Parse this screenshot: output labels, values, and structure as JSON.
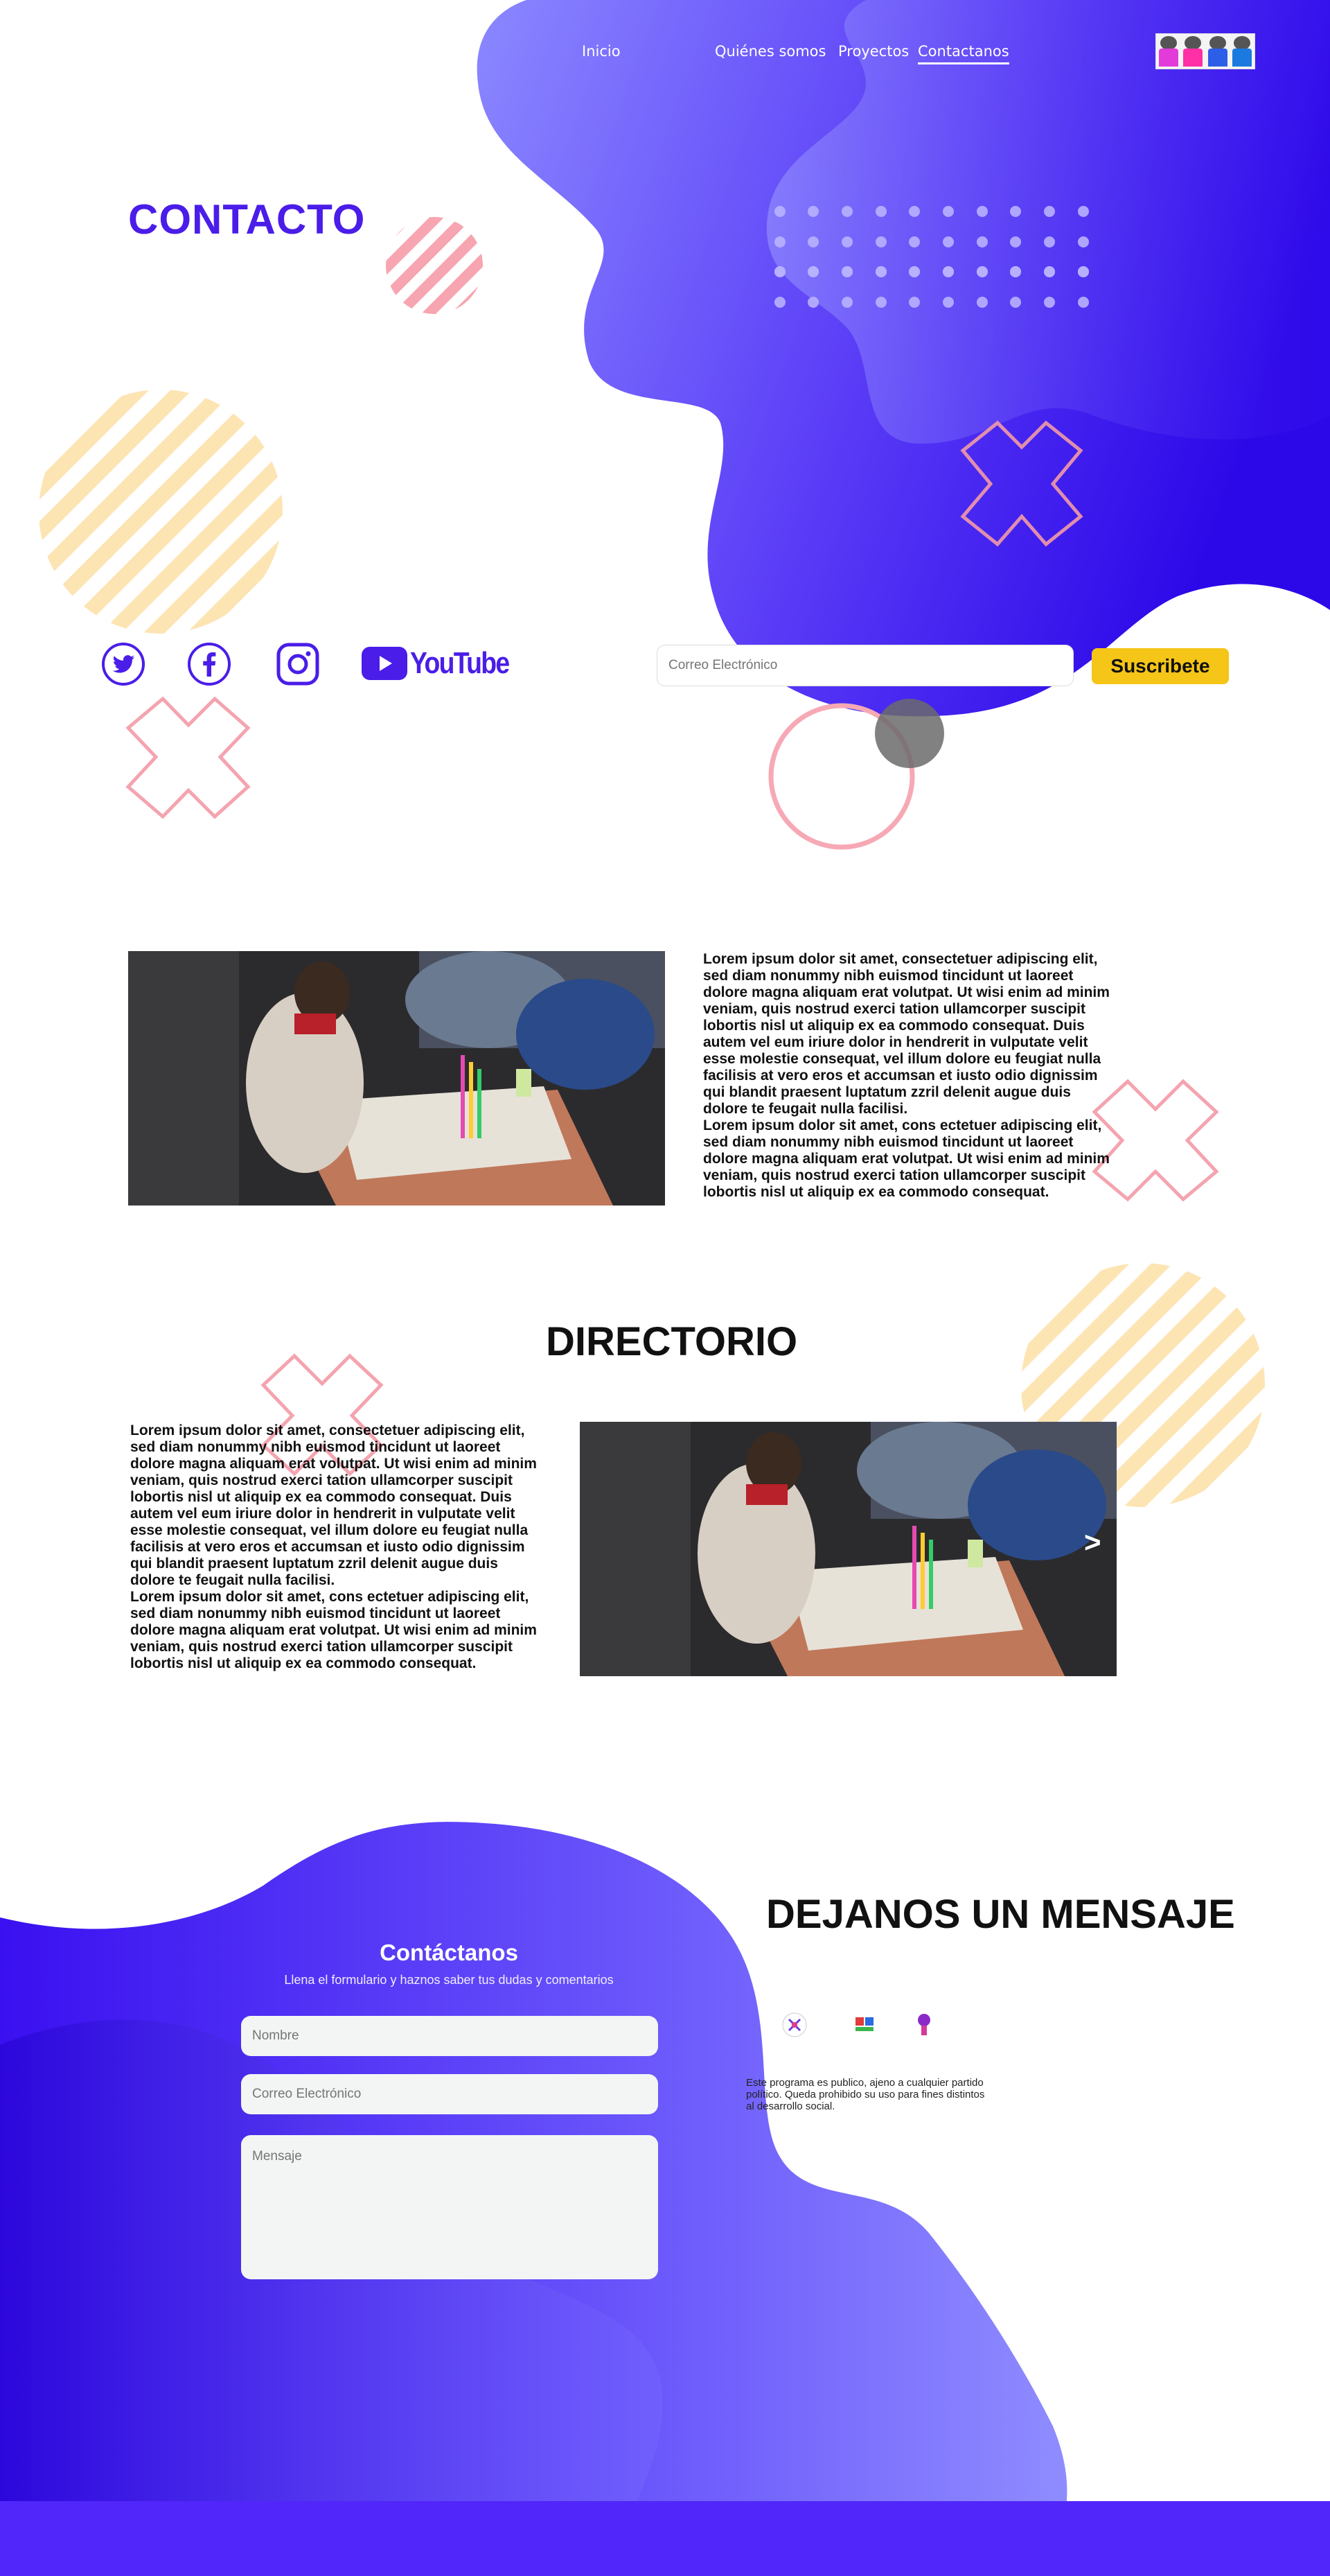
{
  "nav": {
    "items": [
      {
        "label": "Inicio"
      },
      {
        "label": "Quiénes somos"
      },
      {
        "label": "Proyectos"
      },
      {
        "label": "Contactanos"
      }
    ]
  },
  "hero": {
    "title": "CONTACTO"
  },
  "social": {
    "youtube_label": "YouTube"
  },
  "subscribe": {
    "email_placeholder": "Correo Electrónico",
    "button_label": "Suscribete"
  },
  "intro": {
    "paragraph": "Lorem ipsum dolor sit amet, consectetuer adipiscing elit, sed diam nonummy nibh euismod tincidunt ut laoreet dolore magna aliquam erat volutpat. Ut wisi enim ad minim veniam, quis nostrud exerci tation ullamcorper suscipit lobortis nisl ut aliquip ex ea commodo consequat. Duis autem vel eum iriure dolor in hendrerit in vulputate velit esse molestie consequat, vel illum dolore eu feugiat nulla facilisis at vero eros et accumsan et iusto odio dignissim qui blandit praesent luptatum zzril delenit augue duis dolore te feugait nulla facilisi.\nLorem ipsum dolor sit amet, cons ectetuer adipiscing elit, sed diam nonummy nibh euismod tincidunt ut laoreet dolore magna aliquam erat volutpat. Ut wisi enim ad minim veniam, quis nostrud exerci tation ullamcorper suscipit lobortis nisl ut aliquip ex ea commodo consequat."
  },
  "directorio": {
    "title": "DIRECTORIO",
    "paragraph": "Lorem ipsum dolor sit amet, consectetuer adipiscing elit, sed diam nonummy nibh euismod tincidunt ut laoreet dolore magna aliquam erat volutpat. Ut wisi enim ad minim veniam, quis nostrud exerci tation ullamcorper suscipit lobortis nisl ut aliquip ex ea commodo consequat. Duis autem vel eum iriure dolor in hendrerit in vulputate velit esse molestie consequat, vel illum dolore eu feugiat nulla facilisis at vero eros et accumsan et iusto odio dignissim qui blandit praesent luptatum zzril delenit augue duis dolore te feugait nulla facilisi.\nLorem ipsum dolor sit amet, cons ectetuer adipiscing elit, sed diam nonummy nibh euismod tincidunt ut laoreet dolore magna aliquam erat volutpat. Ut wisi enim ad minim veniam, quis nostrud exerci tation ullamcorper suscipit lobortis nisl ut aliquip ex ea commodo consequat.",
    "next_arrow": ">"
  },
  "contact_form": {
    "title": "Contáctanos",
    "subtitle": "Llena el formulario y haznos saber tus dudas y comentarios",
    "name_placeholder": "Nombre",
    "email_placeholder": "Correo Electrónico",
    "message_placeholder": "Mensaje"
  },
  "message_section": {
    "title": "DEJANOS UN MENSAJE",
    "disclaimer": "Este programa es publico, ajeno a cualquier partido  político. Queda prohibido su uso para fines distintos al desarrollo social."
  },
  "colors": {
    "brand_purple": "#4a1de8",
    "accent_yellow": "#f5c518",
    "blob_light": "#8a86ff",
    "blob_dark": "#3a10f0",
    "pink": "#f4a3ad",
    "stripe_yellow": "#fde4b3"
  }
}
